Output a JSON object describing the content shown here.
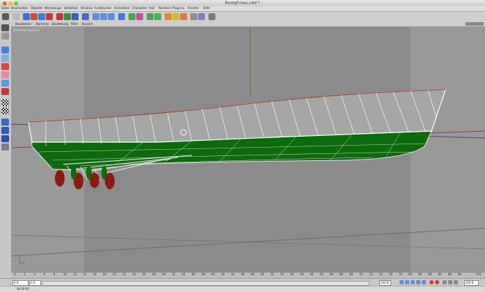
{
  "window": {
    "title": "Rumpf-neu.c4d *"
  },
  "menu": [
    "Datei",
    "Bearbeiten",
    "Objekte",
    "Werkzeuge",
    "Selektion",
    "Struktur",
    "Funktionen",
    "Animation",
    "Character",
    "Hair",
    "Rendern",
    "Plug-ins",
    "Fenster",
    "Hilfe"
  ],
  "viewport_menu": [
    "Bearbeiten",
    "Kameras",
    "Darstellung",
    "Filter",
    "Ansicht"
  ],
  "viewport": {
    "label": "Zentralperspektive"
  },
  "timeline": {
    "ticks": [
      "0",
      "2",
      "4",
      "6",
      "8",
      "10",
      "12",
      "14",
      "16",
      "18",
      "20",
      "22",
      "24",
      "26",
      "28",
      "30",
      "32",
      "34",
      "36",
      "38",
      "40",
      "42",
      "44",
      "46",
      "48",
      "50",
      "52",
      "54",
      "56",
      "58",
      "60",
      "62",
      "64",
      "66",
      "68",
      "70",
      "72",
      "74",
      "76",
      "78",
      "80",
      "82",
      "84",
      "86",
      "88",
      "90"
    ],
    "end_label": "0 B"
  },
  "transport": {
    "start_field": "0 B",
    "current_field": "0 B",
    "end_field": "100 B",
    "end2_field": "100 B"
  },
  "status": {
    "time": "00:00:00"
  },
  "colors": {
    "hull_green": "#0d6b0d",
    "wire": "#ffffff",
    "propeller": "#8c1a10",
    "viewport_bg": "#8b8b8b",
    "side_panel": "#9a9a9a"
  }
}
